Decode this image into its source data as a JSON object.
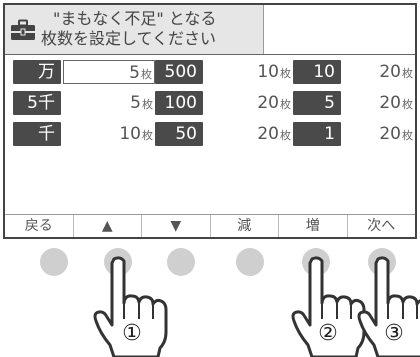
{
  "header": {
    "line1": "\"まもなく不足\" となる",
    "line2": "枚数を設定してください",
    "icon": "cash-box-icon"
  },
  "unit": "枚",
  "rows": [
    {
      "cells": [
        {
          "label": "万",
          "value": "5"
        },
        {
          "label": "500",
          "value": "10"
        },
        {
          "label": "10",
          "value": "20"
        }
      ]
    },
    {
      "cells": [
        {
          "label": "5千",
          "value": "5"
        },
        {
          "label": "100",
          "value": "20"
        },
        {
          "label": "5",
          "value": "20"
        }
      ]
    },
    {
      "cells": [
        {
          "label": "千",
          "value": "10"
        },
        {
          "label": "50",
          "value": "20"
        },
        {
          "label": "1",
          "value": "20"
        }
      ]
    }
  ],
  "footer": {
    "back": "戻る",
    "up": "▲",
    "down": "▼",
    "decrease": "減",
    "increase": "増",
    "next": "次へ"
  },
  "callouts": [
    "①",
    "②",
    "③"
  ],
  "colors": {
    "label_bg": "#4a4a4a",
    "header_bg": "#e6e6e6",
    "hw_button": "#cfcfcf"
  }
}
